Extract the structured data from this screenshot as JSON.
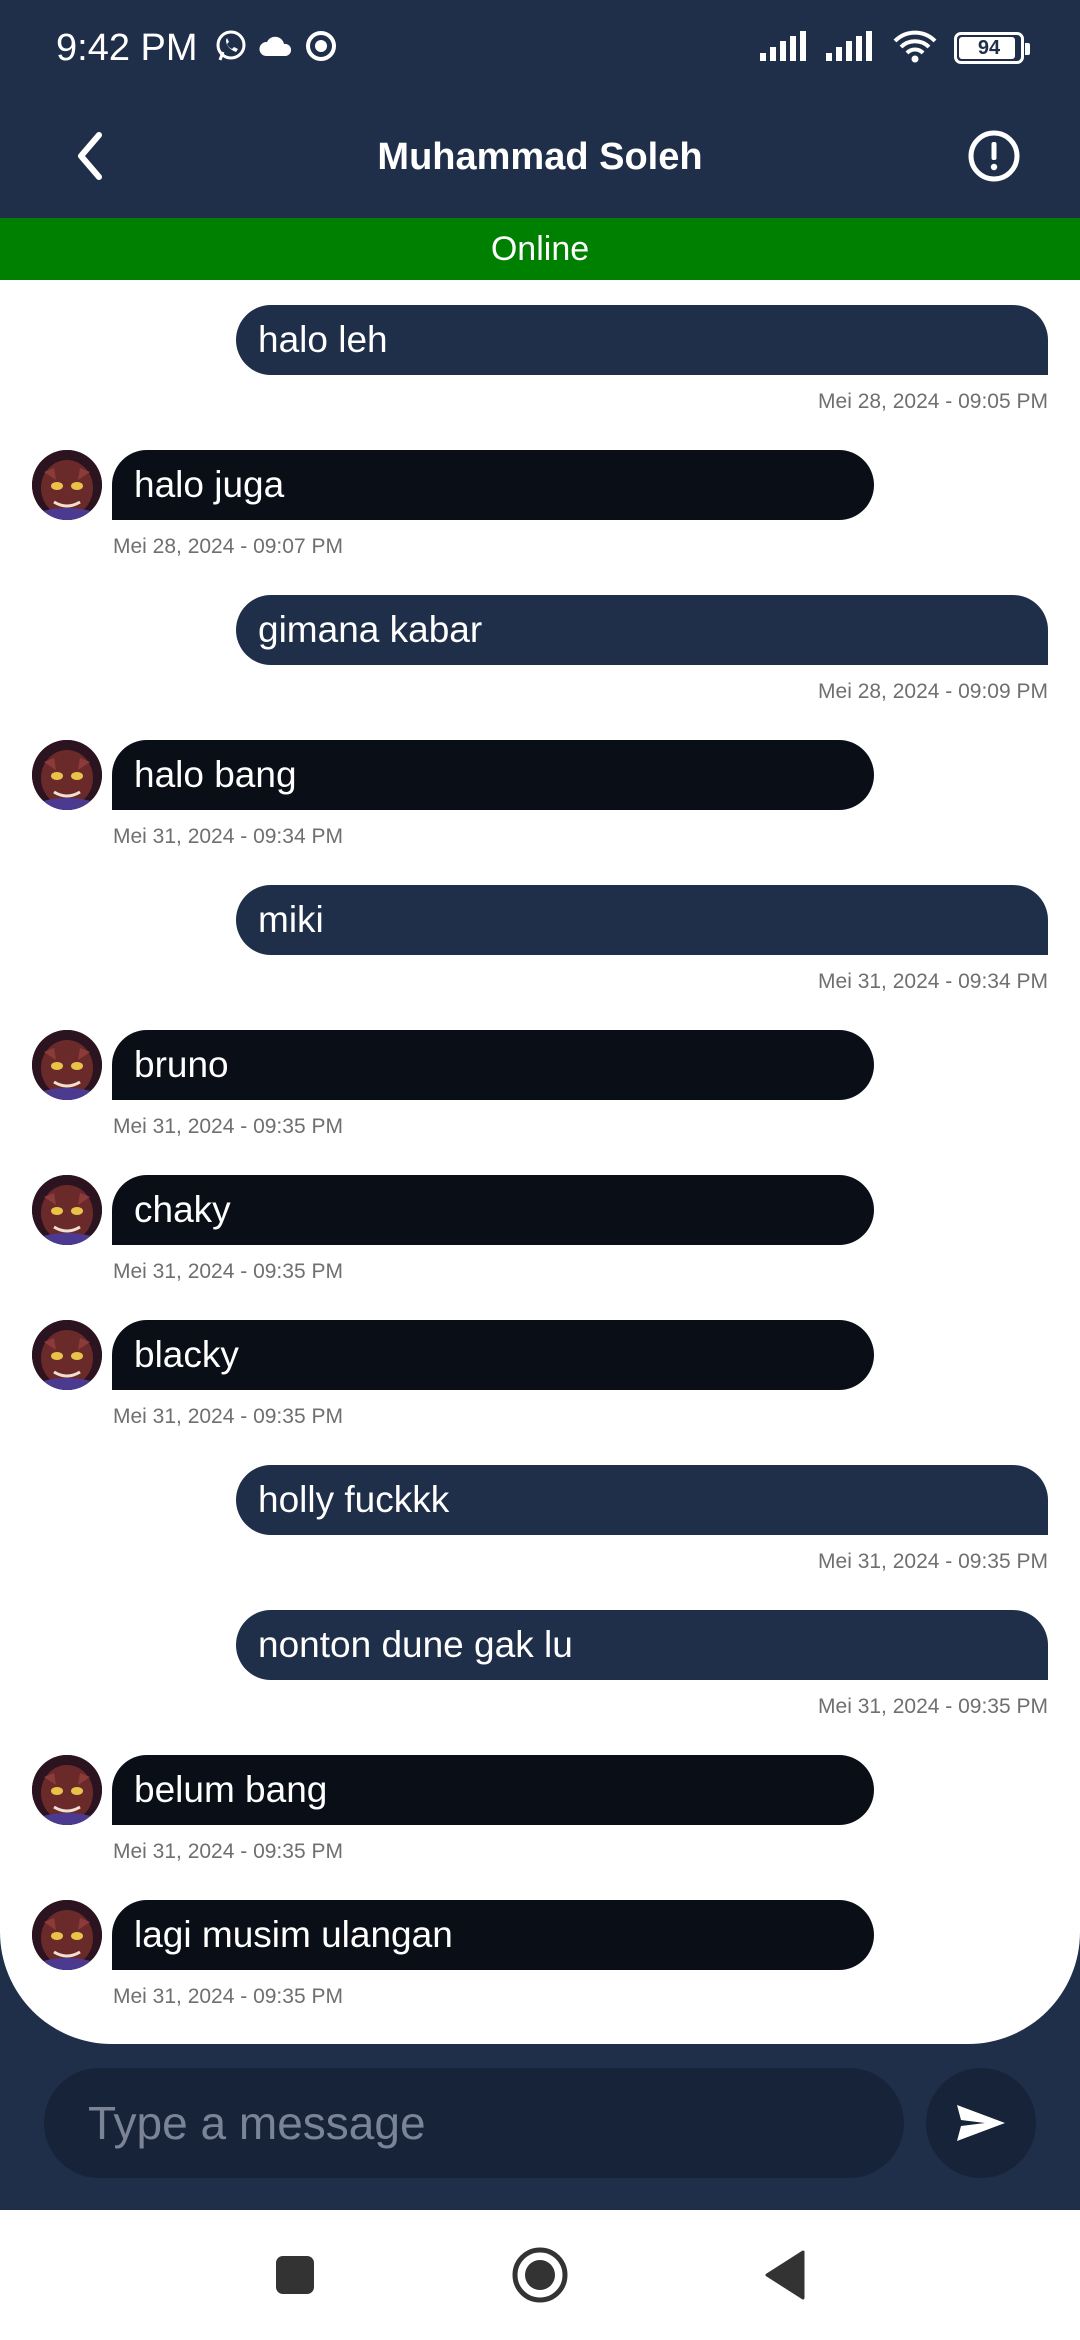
{
  "status_bar": {
    "time": "9:42 PM",
    "battery": "94",
    "battery_level": 0.94
  },
  "header": {
    "title": "Muhammad Soleh",
    "status": "Online"
  },
  "messages": [
    {
      "direction": "out",
      "text": "halo leh",
      "time": "Mei 28, 2024 - 09:05 PM"
    },
    {
      "direction": "in",
      "text": "halo juga",
      "time": "Mei 28, 2024 - 09:07 PM"
    },
    {
      "direction": "out",
      "text": "gimana kabar",
      "time": "Mei 28, 2024 - 09:09 PM"
    },
    {
      "direction": "in",
      "text": "halo bang",
      "time": "Mei 31, 2024 - 09:34 PM"
    },
    {
      "direction": "out",
      "text": "miki",
      "time": "Mei 31, 2024 - 09:34 PM"
    },
    {
      "direction": "in",
      "text": "bruno",
      "time": "Mei 31, 2024 - 09:35 PM"
    },
    {
      "direction": "in",
      "text": "chaky",
      "time": "Mei 31, 2024 - 09:35 PM"
    },
    {
      "direction": "in",
      "text": "blacky",
      "time": "Mei 31, 2024 - 09:35 PM"
    },
    {
      "direction": "out",
      "text": "holly fuckkk",
      "time": "Mei 31, 2024 - 09:35 PM"
    },
    {
      "direction": "out",
      "text": "nonton dune gak lu",
      "time": "Mei 31, 2024 - 09:35 PM"
    },
    {
      "direction": "in",
      "text": "belum bang",
      "time": "Mei 31, 2024 - 09:35 PM"
    },
    {
      "direction": "in",
      "text": "lagi musim ulangan",
      "time": "Mei 31, 2024 - 09:35 PM"
    }
  ],
  "composer": {
    "placeholder": "Type a message",
    "value": ""
  },
  "icons": {
    "back": "chevron-left-icon",
    "info": "alert-circle-icon",
    "send": "send-icon",
    "nav_recents": "square-icon",
    "nav_home": "circle-icon",
    "nav_back": "triangle-back-icon"
  },
  "colors": {
    "header_bg": "#1f2e49",
    "online_bar": "#008000",
    "outgoing_bubble": "#1f2e49",
    "incoming_bubble": "#0a0e17"
  }
}
